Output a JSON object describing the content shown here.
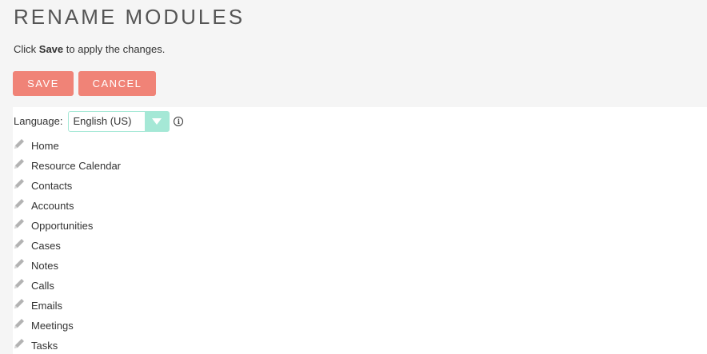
{
  "header": {
    "title": "RENAME MODULES",
    "instructions_prefix": "Click ",
    "instructions_bold": "Save",
    "instructions_suffix": " to apply the changes."
  },
  "buttons": {
    "save_label": "SAVE",
    "cancel_label": "CANCEL"
  },
  "language": {
    "label": "Language:",
    "selected": "English (US)"
  },
  "modules": [
    {
      "label": "Home",
      "icon": "pencil-icon"
    },
    {
      "label": "Resource Calendar",
      "icon": "pencil-icon"
    },
    {
      "label": "Contacts",
      "icon": "pencil-icon"
    },
    {
      "label": "Accounts",
      "icon": "pencil-icon"
    },
    {
      "label": "Opportunities",
      "icon": "pencil-icon"
    },
    {
      "label": "Cases",
      "icon": "pencil-icon"
    },
    {
      "label": "Notes",
      "icon": "pencil-icon"
    },
    {
      "label": "Calls",
      "icon": "pencil-icon"
    },
    {
      "label": "Emails",
      "icon": "pencil-icon"
    },
    {
      "label": "Meetings",
      "icon": "pencil-icon"
    },
    {
      "label": "Tasks",
      "icon": "pencil-icon"
    }
  ],
  "colors": {
    "button_bg": "#f08377",
    "select_accent": "#a5e8d6",
    "page_bg": "#f5f5f5"
  }
}
